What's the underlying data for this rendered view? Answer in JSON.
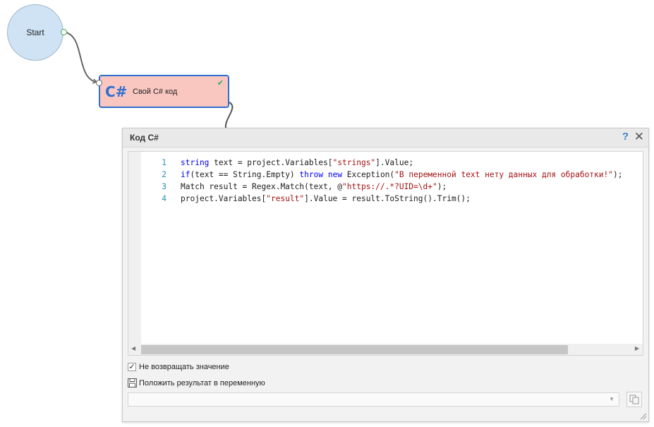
{
  "canvas": {
    "start_label": "Start",
    "cs_node": {
      "logo": "C#",
      "title": "Свой C# код",
      "status_icon": "check-icon"
    }
  },
  "dialog": {
    "title": "Код C#",
    "help_label": "?",
    "close_label": "✕",
    "code_lines": [
      {
        "num": "1",
        "text": "string text = project.Variables[\"strings\"].Value;"
      },
      {
        "num": "2",
        "text": "if(text == String.Empty) throw new Exception(\"В переменной text нету данных для обработки!\");"
      },
      {
        "num": "3",
        "text": "Match result = Regex.Match(text, @\"https://.*?UID=\\d+\");"
      },
      {
        "num": "4",
        "text": "project.Variables[\"result\"].Value = result.ToString().Trim();"
      }
    ],
    "checkbox_label": "Не возвращать значение",
    "checkbox_checked": true,
    "save_label": "Положить результат в переменную",
    "variable_value": ""
  },
  "colors": {
    "start_fill": "#cfe3f5",
    "node_fill": "#f9c7c0",
    "node_border": "#2f6fd1",
    "keyword": "#0000ff",
    "string": "#a31515"
  }
}
